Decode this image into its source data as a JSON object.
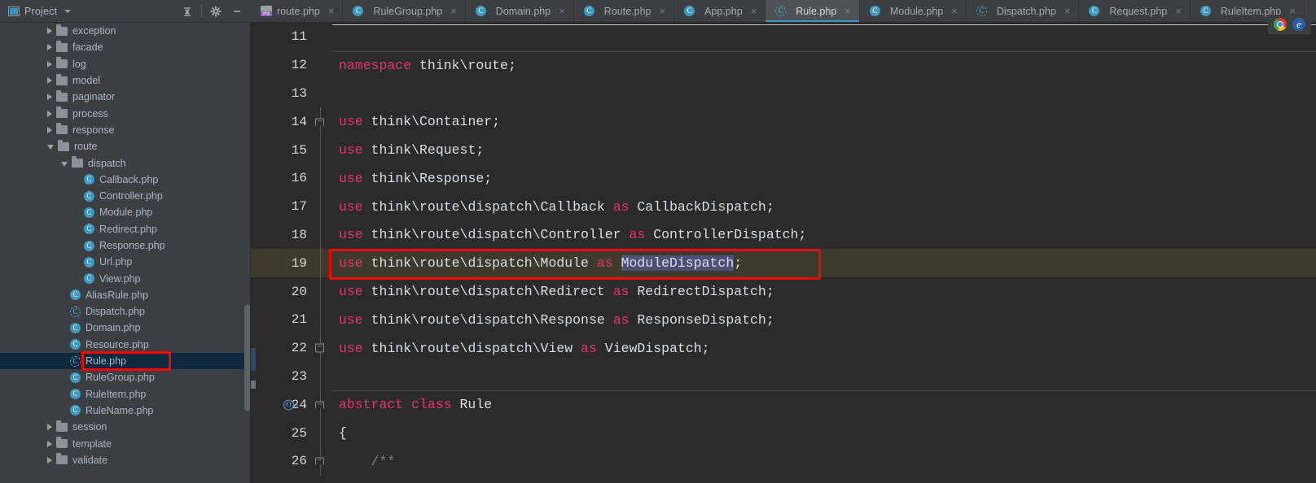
{
  "sidebar": {
    "header": {
      "title": "Project",
      "icons": [
        "project-icon",
        "chevron-down-icon",
        "collapse-all-icon",
        "gear-icon",
        "minimize-icon"
      ]
    },
    "tree": [
      {
        "label": "exception",
        "type": "folder",
        "indent": 1,
        "state": "collapsed"
      },
      {
        "label": "facade",
        "type": "folder",
        "indent": 1,
        "state": "collapsed"
      },
      {
        "label": "log",
        "type": "folder",
        "indent": 1,
        "state": "collapsed"
      },
      {
        "label": "model",
        "type": "folder",
        "indent": 1,
        "state": "collapsed"
      },
      {
        "label": "paginator",
        "type": "folder",
        "indent": 1,
        "state": "collapsed"
      },
      {
        "label": "process",
        "type": "folder",
        "indent": 1,
        "state": "collapsed"
      },
      {
        "label": "response",
        "type": "folder",
        "indent": 1,
        "state": "collapsed"
      },
      {
        "label": "route",
        "type": "folder",
        "indent": 1,
        "state": "expanded"
      },
      {
        "label": "dispatch",
        "type": "folder",
        "indent": 2,
        "state": "expanded"
      },
      {
        "label": "Callback.php",
        "type": "class",
        "indent": 3,
        "state": "leaf"
      },
      {
        "label": "Controller.php",
        "type": "class",
        "indent": 3,
        "state": "leaf"
      },
      {
        "label": "Module.php",
        "type": "class",
        "indent": 3,
        "state": "leaf"
      },
      {
        "label": "Redirect.php",
        "type": "class",
        "indent": 3,
        "state": "leaf"
      },
      {
        "label": "Response.php",
        "type": "class",
        "indent": 3,
        "state": "leaf"
      },
      {
        "label": "Url.php",
        "type": "class",
        "indent": 3,
        "state": "leaf"
      },
      {
        "label": "View.php",
        "type": "class",
        "indent": 3,
        "state": "leaf"
      },
      {
        "label": "AliasRule.php",
        "type": "class",
        "indent": 2,
        "state": "leaf"
      },
      {
        "label": "Dispatch.php",
        "type": "abstract-class",
        "indent": 2,
        "state": "leaf"
      },
      {
        "label": "Domain.php",
        "type": "class",
        "indent": 2,
        "state": "leaf"
      },
      {
        "label": "Resource.php",
        "type": "class",
        "indent": 2,
        "state": "leaf"
      },
      {
        "label": "Rule.php",
        "type": "abstract-class",
        "indent": 2,
        "state": "leaf",
        "selected": true,
        "annotated": true
      },
      {
        "label": "RuleGroup.php",
        "type": "class",
        "indent": 2,
        "state": "leaf"
      },
      {
        "label": "RuleItem.php",
        "type": "class",
        "indent": 2,
        "state": "leaf"
      },
      {
        "label": "RuleName.php",
        "type": "class",
        "indent": 2,
        "state": "leaf"
      },
      {
        "label": "session",
        "type": "folder",
        "indent": 1,
        "state": "collapsed"
      },
      {
        "label": "template",
        "type": "folder",
        "indent": 1,
        "state": "collapsed"
      },
      {
        "label": "validate",
        "type": "folder",
        "indent": 1,
        "state": "collapsed"
      }
    ]
  },
  "tabs": [
    {
      "label": "route.php",
      "icon": "php-file-icon",
      "active": false
    },
    {
      "label": "RuleGroup.php",
      "icon": "class-icon",
      "active": false
    },
    {
      "label": "Domain.php",
      "icon": "class-icon",
      "active": false
    },
    {
      "label": "Route.php",
      "icon": "class-icon",
      "active": false
    },
    {
      "label": "App.php",
      "icon": "class-icon",
      "active": false
    },
    {
      "label": "Rule.php",
      "icon": "abstract-class-icon",
      "active": true
    },
    {
      "label": "Module.php",
      "icon": "class-icon",
      "active": false
    },
    {
      "label": "Dispatch.php",
      "icon": "abstract-class-icon",
      "active": false
    },
    {
      "label": "Request.php",
      "icon": "class-icon",
      "active": false
    },
    {
      "label": "RuleItem.php",
      "icon": "class-icon",
      "active": false
    }
  ],
  "tab_close_glyph": "×",
  "editor": {
    "lines": [
      {
        "num": "11",
        "text": "",
        "fold": "",
        "current": false,
        "separator_above": false
      },
      {
        "num": "12",
        "text": "namespace think\\route;",
        "kw": "namespace",
        "fold": "",
        "current": false,
        "separator_above": true
      },
      {
        "num": "13",
        "text": "",
        "fold": "",
        "current": false
      },
      {
        "num": "14",
        "text": "use think\\Container;",
        "kw": "use",
        "fold": "start",
        "current": false
      },
      {
        "num": "15",
        "text": "use think\\Request;",
        "kw": "use",
        "fold": "",
        "current": false
      },
      {
        "num": "16",
        "text": "use think\\Response;",
        "kw": "use",
        "fold": "",
        "current": false
      },
      {
        "num": "17",
        "text": "use think\\route\\dispatch\\Callback as CallbackDispatch;",
        "kw": "use",
        "kw2": "as",
        "fold": "",
        "current": false
      },
      {
        "num": "18",
        "text": "use think\\route\\dispatch\\Controller as ControllerDispatch;",
        "kw": "use",
        "kw2": "as",
        "fold": "",
        "current": false
      },
      {
        "num": "19",
        "text": "use think\\route\\dispatch\\Module as ModuleDispatch;",
        "kw": "use",
        "kw2": "as",
        "fold": "",
        "current": true,
        "selection": "ModuleDispatch",
        "annotated": true
      },
      {
        "num": "20",
        "text": "use think\\route\\dispatch\\Redirect as RedirectDispatch;",
        "kw": "use",
        "kw2": "as",
        "fold": "",
        "current": false
      },
      {
        "num": "21",
        "text": "use think\\route\\dispatch\\Response as ResponseDispatch;",
        "kw": "use",
        "kw2": "as",
        "fold": "",
        "current": false
      },
      {
        "num": "22",
        "text": "use think\\route\\dispatch\\View as ViewDispatch;",
        "kw": "use",
        "kw2": "as",
        "fold": "end",
        "current": false
      },
      {
        "num": "23",
        "text": "",
        "fold": "",
        "current": false
      },
      {
        "num": "24",
        "text": "abstract class Rule",
        "kw": "abstract class",
        "fold": "start",
        "current": false,
        "separator_above": true,
        "marker": "subclass-marker"
      },
      {
        "num": "25",
        "text": "{",
        "fold": "",
        "current": false
      },
      {
        "num": "26",
        "text": "    /**",
        "fold": "start",
        "current": false,
        "comment": true
      }
    ]
  },
  "browser_launchers": [
    {
      "name": "chrome-icon"
    },
    {
      "name": "edge-icon",
      "glyph": "e"
    }
  ],
  "colors": {
    "accent": "#3d9bbf",
    "keyword": "#e8336d",
    "selection": "#4f4f78",
    "current_line": "#3c3b2e",
    "annotation": "#ff0000",
    "tree_selected": "#0d293e",
    "editor_bg": "#2b2b2b",
    "panel_bg": "#3c3f41"
  }
}
